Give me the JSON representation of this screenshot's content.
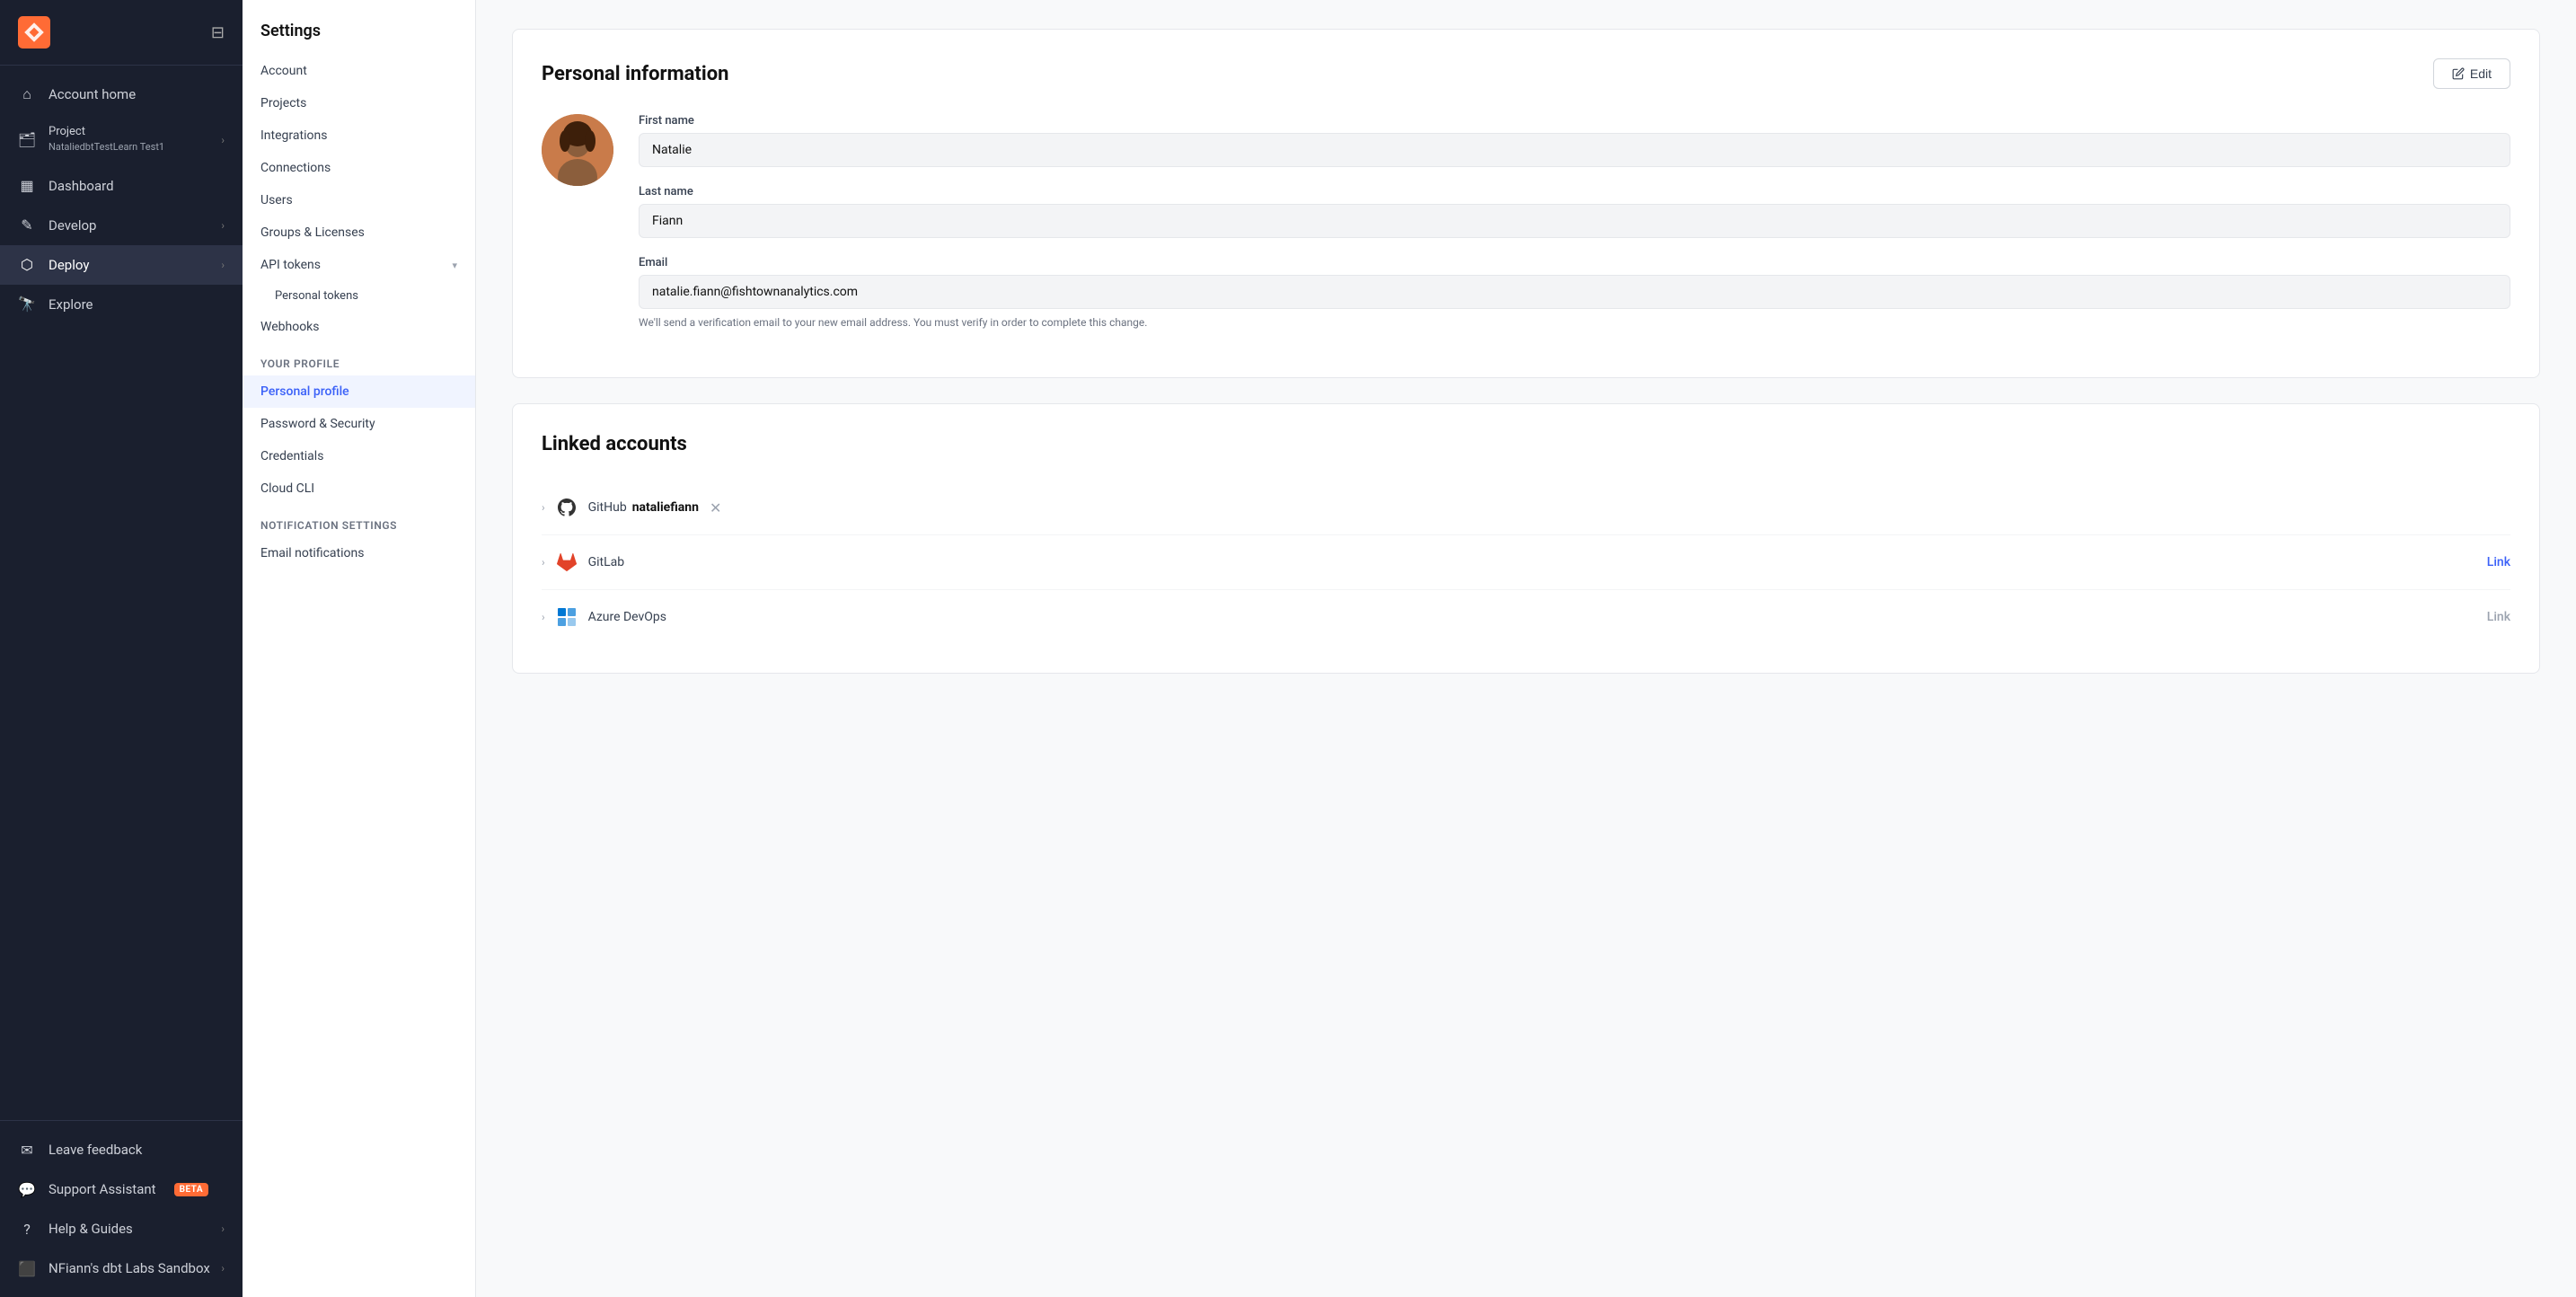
{
  "leftSidebar": {
    "logo": "dbt",
    "toggleIcon": "sidebar-toggle-icon",
    "navItems": [
      {
        "id": "account-home",
        "label": "Account home",
        "icon": "home-icon",
        "hasChevron": false,
        "active": false
      },
      {
        "id": "project",
        "label": "Project\nNataliedbtTestLearn Test1",
        "icon": "project-icon",
        "hasChevron": true,
        "active": false
      },
      {
        "id": "dashboard",
        "label": "Dashboard",
        "icon": "dashboard-icon",
        "hasChevron": false,
        "active": false
      },
      {
        "id": "develop",
        "label": "Develop",
        "icon": "develop-icon",
        "hasChevron": true,
        "active": false
      },
      {
        "id": "deploy",
        "label": "Deploy",
        "icon": "deploy-icon",
        "hasChevron": true,
        "active": true
      },
      {
        "id": "explore",
        "label": "Explore",
        "icon": "explore-icon",
        "hasChevron": false,
        "active": false
      }
    ],
    "bottomItems": [
      {
        "id": "leave-feedback",
        "label": "Leave feedback",
        "icon": "feedback-icon",
        "hasChevron": false
      },
      {
        "id": "support-assistant",
        "label": "Support Assistant",
        "icon": "support-icon",
        "hasChevron": false,
        "badge": "BETA"
      },
      {
        "id": "help-guides",
        "label": "Help & Guides",
        "icon": "help-icon",
        "hasChevron": true
      },
      {
        "id": "nfiann-sandbox",
        "label": "NFiann's dbt Labs Sandbox",
        "icon": "sandbox-icon",
        "hasChevron": true
      }
    ]
  },
  "settingsSidebar": {
    "title": "Settings",
    "sections": [
      {
        "items": [
          {
            "id": "account",
            "label": "Account",
            "hasChevron": false
          },
          {
            "id": "projects",
            "label": "Projects",
            "hasChevron": false
          },
          {
            "id": "integrations",
            "label": "Integrations",
            "hasChevron": false
          },
          {
            "id": "connections",
            "label": "Connections",
            "hasChevron": false
          },
          {
            "id": "users",
            "label": "Users",
            "hasChevron": false
          },
          {
            "id": "groups-licenses",
            "label": "Groups & Licenses",
            "hasChevron": false
          },
          {
            "id": "api-tokens",
            "label": "API tokens",
            "hasChevron": true
          },
          {
            "id": "personal-tokens",
            "label": "Personal tokens",
            "sub": true
          },
          {
            "id": "webhooks",
            "label": "Webhooks",
            "hasChevron": false
          }
        ]
      },
      {
        "sectionLabel": "Your profile",
        "items": [
          {
            "id": "personal-profile",
            "label": "Personal profile",
            "active": true
          },
          {
            "id": "password-security",
            "label": "Password & Security"
          },
          {
            "id": "credentials",
            "label": "Credentials"
          },
          {
            "id": "cloud-cli",
            "label": "Cloud CLI"
          }
        ]
      },
      {
        "sectionLabel": "Notification settings",
        "items": [
          {
            "id": "email-notifications",
            "label": "Email notifications"
          }
        ]
      }
    ]
  },
  "mainContent": {
    "personalInfo": {
      "title": "Personal information",
      "editLabel": "Edit",
      "editIcon": "pencil-icon",
      "avatarInitials": "👩",
      "fields": [
        {
          "label": "First name",
          "value": "Natalie"
        },
        {
          "label": "Last name",
          "value": "Fiann"
        },
        {
          "label": "Email",
          "value": "natalie.fiann@fishtownanalytics.com",
          "hint": "We'll send a verification email to your new email address. You must verify in order to complete this change."
        }
      ]
    },
    "linkedAccounts": {
      "title": "Linked accounts",
      "accounts": [
        {
          "id": "github",
          "name": "GitHub",
          "username": "nataliefiann",
          "icon": "github-icon",
          "action": "close",
          "actionLabel": "×",
          "linked": true
        },
        {
          "id": "gitlab",
          "name": "GitLab",
          "username": "",
          "icon": "gitlab-icon",
          "action": "link",
          "actionLabel": "Link",
          "linked": false
        },
        {
          "id": "azure-devops",
          "name": "Azure DevOps",
          "username": "",
          "icon": "azure-icon",
          "action": "link",
          "actionLabel": "Link",
          "linked": false,
          "muted": true
        }
      ]
    }
  }
}
